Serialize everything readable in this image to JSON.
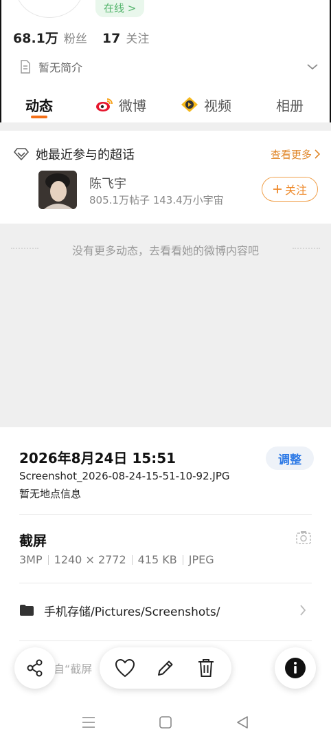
{
  "profile": {
    "online_status": "在线",
    "online_arrow": ">",
    "followers_count": "68.1万",
    "followers_label": "粉丝",
    "following_count": "17",
    "following_label": "关注",
    "bio": "暂无简介"
  },
  "tabs": [
    {
      "label": "动态",
      "icon": "none",
      "active": true
    },
    {
      "label": "微博",
      "icon": "weibo-icon",
      "active": false
    },
    {
      "label": "视频",
      "icon": "video-icon",
      "active": false
    },
    {
      "label": "相册",
      "icon": "none",
      "active": false
    }
  ],
  "super_topic": {
    "title": "她最近参与的超话",
    "see_more": "查看更多",
    "item": {
      "name": "陈飞宇",
      "meta": "805.1万帖子 143.4万小宇宙",
      "follow_label": "关注"
    }
  },
  "feed": {
    "empty_message": "没有更多动态，去看看她的微博内容吧"
  },
  "photo_info": {
    "datetime": "2026年8月24日 15:51",
    "adjust_label": "调整",
    "file_name": "Screenshot_2026-08-24-15-51-10-92.JPG",
    "location": "暂无地点信息",
    "category": "截屏",
    "resolution": "3MP",
    "dimensions": "1240 × 2772",
    "file_size": "415 KB",
    "format": "JPEG",
    "path": "手机存储/Pictures/Screenshots/",
    "source_partial": "来自“截屏"
  },
  "colors": {
    "accent_orange": "#f46f17",
    "online_green": "#52b36a",
    "link_blue": "#2e7ae6",
    "follow_orange": "#ee8a2c"
  }
}
